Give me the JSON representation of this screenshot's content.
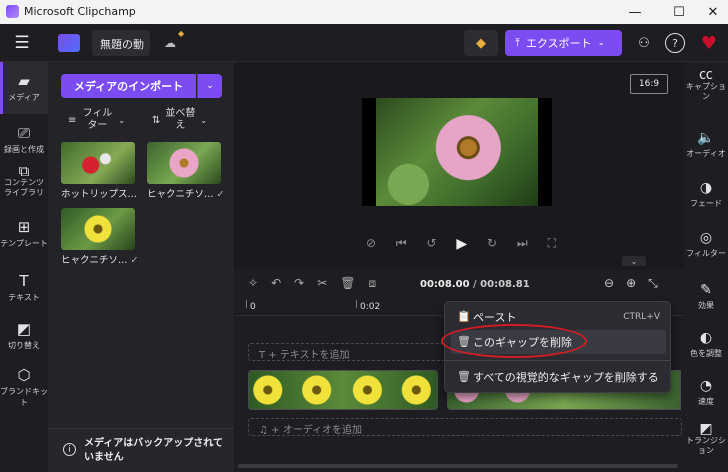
{
  "window": {
    "title": "Microsoft Clipchamp",
    "controls": [
      "—",
      "☐",
      "✕"
    ]
  },
  "topbar": {
    "project_name": "無題の動",
    "export_label": "エクスポート",
    "colors": {
      "accent": "#7a4cf2",
      "premium": "#e8b03a",
      "heart": "#c8102e"
    }
  },
  "leftnav": {
    "items": [
      {
        "label": "メディア",
        "icon": "folder-icon"
      },
      {
        "label": "録画と作成",
        "icon": "camera-icon"
      },
      {
        "label": "コンテンツ\nライブラリ",
        "icon": "library-icon"
      },
      {
        "label": "テンプレート",
        "icon": "template-icon"
      },
      {
        "label": "テキスト",
        "icon": "text-icon"
      },
      {
        "label": "切り替え",
        "icon": "transition-icon"
      },
      {
        "label": "ブランドキット",
        "icon": "brand-icon"
      }
    ]
  },
  "media": {
    "import_label": "メディアのインポート",
    "filter_label": "フィルター",
    "sort_label": "並べ替え",
    "items": [
      {
        "name": "ホットリップス…",
        "checked": false
      },
      {
        "name": "ヒャクニチソ…",
        "checked": true
      },
      {
        "name": "ヒャクニチソ…",
        "checked": true
      }
    ],
    "backup_notice": "メディアはバックアップされていません"
  },
  "preview": {
    "aspect": "16:9"
  },
  "timeline": {
    "current_time": "00:08.00",
    "total_time": "00:08.81",
    "ruler": [
      "0",
      "0:02"
    ],
    "text_track_hint": "+ テキストを追加",
    "audio_track_hint": "+ オーディオを追加"
  },
  "context_menu": {
    "items": [
      {
        "label": "ペースト",
        "shortcut": "CTRL+V"
      },
      {
        "label": "このギャップを削除",
        "shortcut": ""
      },
      {
        "label": "すべての視覚的なギャップを削除する",
        "shortcut": ""
      }
    ]
  },
  "rightnav": {
    "items": [
      {
        "label": "キャプション",
        "icon": "captions-icon"
      },
      {
        "label": "オーディオ",
        "icon": "speaker-icon"
      },
      {
        "label": "フェード",
        "icon": "fade-icon"
      },
      {
        "label": "フィルター",
        "icon": "filter-icon"
      },
      {
        "label": "効果",
        "icon": "effects-icon"
      },
      {
        "label": "色を調整",
        "icon": "color-icon"
      },
      {
        "label": "速度",
        "icon": "speed-icon"
      },
      {
        "label": "トランジション",
        "icon": "transition-icon"
      }
    ]
  }
}
